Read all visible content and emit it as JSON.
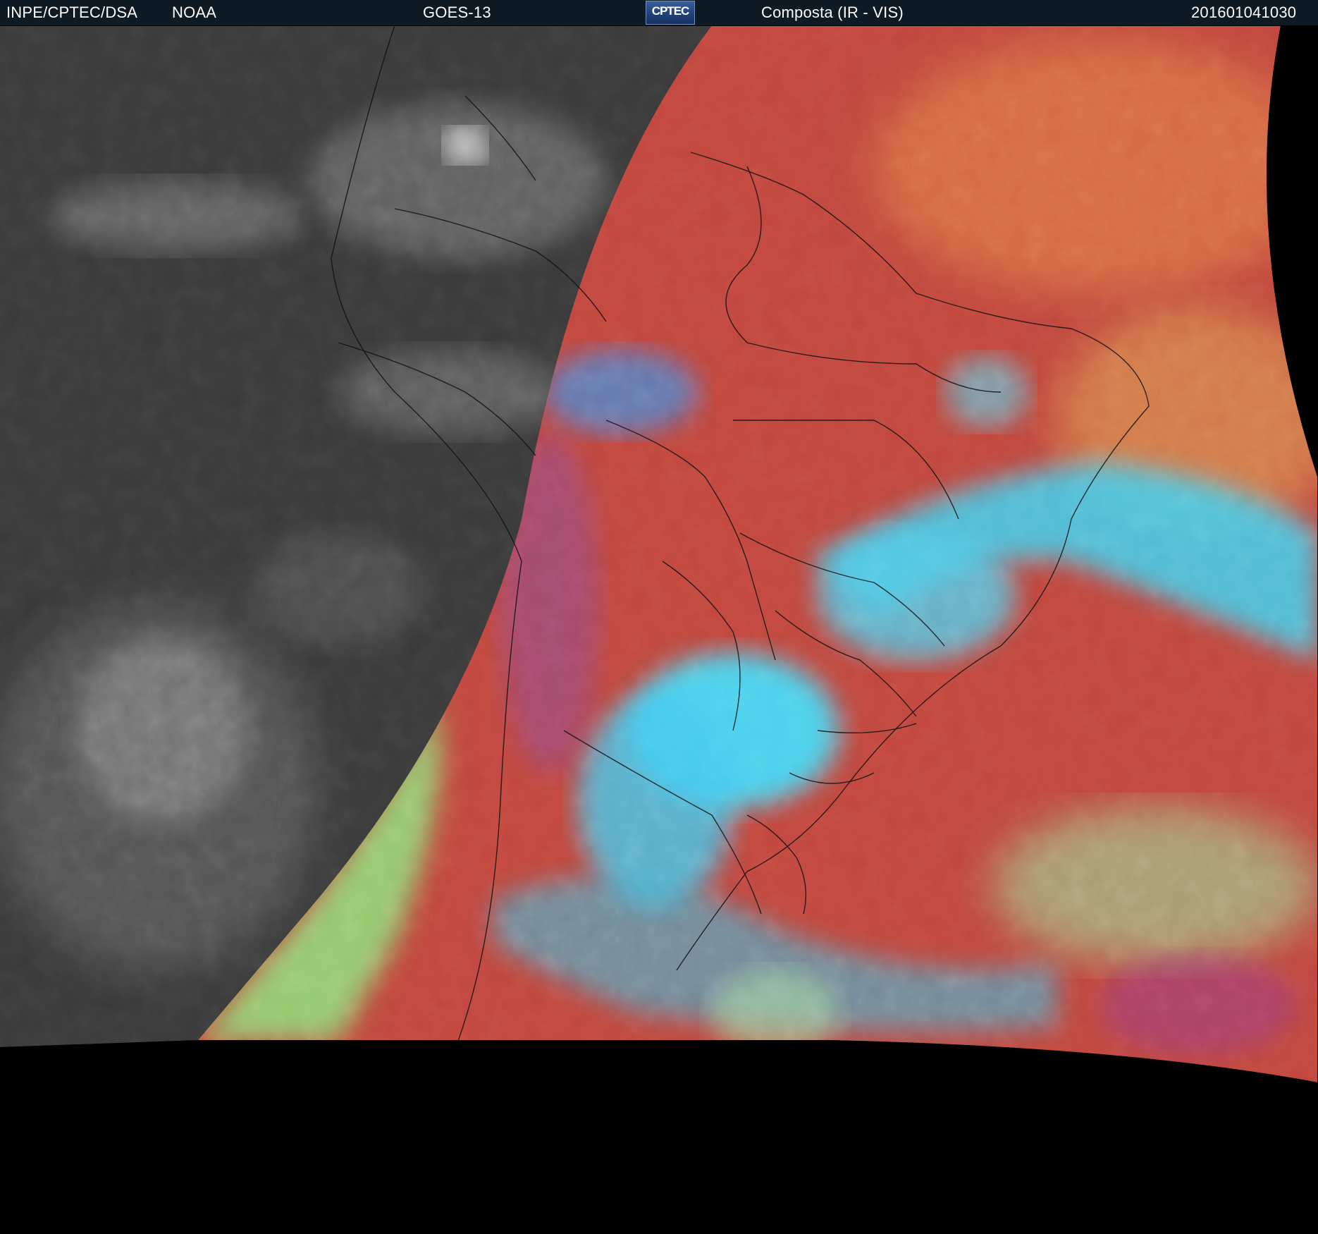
{
  "header": {
    "source": "INPE/CPTEC/DSA",
    "agency": "NOAA",
    "satellite": "GOES-13",
    "logo_text": "CPTEC",
    "product": "Composta (IR - VIS)",
    "timestamp": "201601041030"
  },
  "colors": {
    "header_bg": "#0e1a24",
    "ocean_composite": "#c0473e",
    "night_gray": "#3a3a3a",
    "cloud_cyan": "#3fd0f0",
    "low_cloud_green": "#8fe07a",
    "background": "#000000",
    "border_lines": "#111111"
  }
}
